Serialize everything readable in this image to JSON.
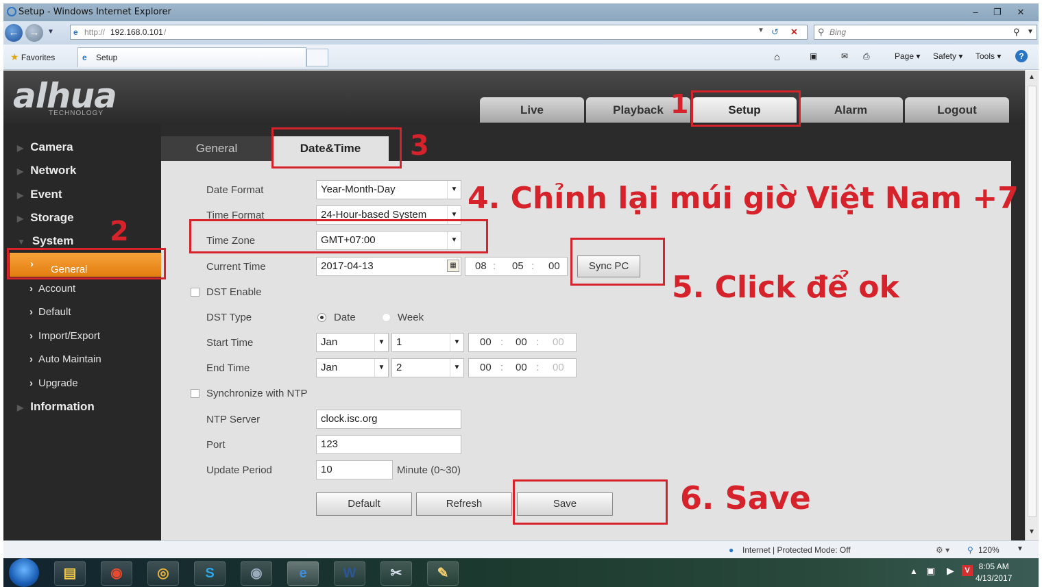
{
  "window": {
    "title": "Setup - Windows Internet Explorer"
  },
  "browser": {
    "url_proto": "http://",
    "url_host": "192.168.0.101",
    "url_tail": "/",
    "search_placeholder": "Bing",
    "favorites_label": "Favorites",
    "tab_title": "Setup",
    "commands": {
      "page": "Page",
      "safety": "Safety",
      "tools": "Tools"
    }
  },
  "app": {
    "logo": "alhua",
    "logo_sub": "TECHNOLOGY",
    "nav": [
      "Live",
      "Playback",
      "Setup",
      "Alarm",
      "Logout"
    ],
    "sidebar": {
      "camera": "Camera",
      "network": "Network",
      "event": "Event",
      "storage": "Storage",
      "system": "System",
      "sub": [
        "General",
        "Account",
        "Default",
        "Import/Export",
        "Auto Maintain",
        "Upgrade"
      ],
      "information": "Information"
    },
    "subtabs": [
      "General",
      "Date&Time"
    ]
  },
  "form": {
    "date_format": {
      "label": "Date Format",
      "value": "Year-Month-Day"
    },
    "time_format": {
      "label": "Time Format",
      "value": "24-Hour-based System"
    },
    "time_zone": {
      "label": "Time Zone",
      "value": "GMT+07:00"
    },
    "current_time": {
      "label": "Current Time",
      "date": "2017-04-13",
      "hh": "08",
      "mm": "05",
      "ss": "00",
      "sync_button": "Sync PC"
    },
    "dst_enable": {
      "label": "DST Enable"
    },
    "dst_type": {
      "label": "DST Type",
      "opt_date": "Date",
      "opt_week": "Week"
    },
    "start_time": {
      "label": "Start Time",
      "month": "Jan",
      "day": "1",
      "hh": "00",
      "mm": "00",
      "ss": "00"
    },
    "end_time": {
      "label": "End Time",
      "month": "Jan",
      "day": "2",
      "hh": "00",
      "mm": "00",
      "ss": "00"
    },
    "ntp_sync": {
      "label": "Synchronize with NTP"
    },
    "ntp_server": {
      "label": "NTP Server",
      "value": "clock.isc.org"
    },
    "port": {
      "label": "Port",
      "value": "123"
    },
    "update_period": {
      "label": "Update Period",
      "value": "10",
      "hint": "Minute (0~30)"
    },
    "buttons": {
      "default": "Default",
      "refresh": "Refresh",
      "save": "Save"
    }
  },
  "annotations": {
    "n1": "1",
    "n2": "2",
    "n3": "3",
    "n4": "4. Chỉnh lại múi giờ Việt Nam +7",
    "n5": "5. Click để ok",
    "n6": "6. Save"
  },
  "statusbar": {
    "zone": "Internet | Protected Mode: Off",
    "zoom": "120%"
  },
  "taskbar": {
    "time": "8:05 AM",
    "date": "4/13/2017"
  },
  "colors": {
    "annotation_red": "#d6232b",
    "active_orange": "#f08a1c"
  }
}
